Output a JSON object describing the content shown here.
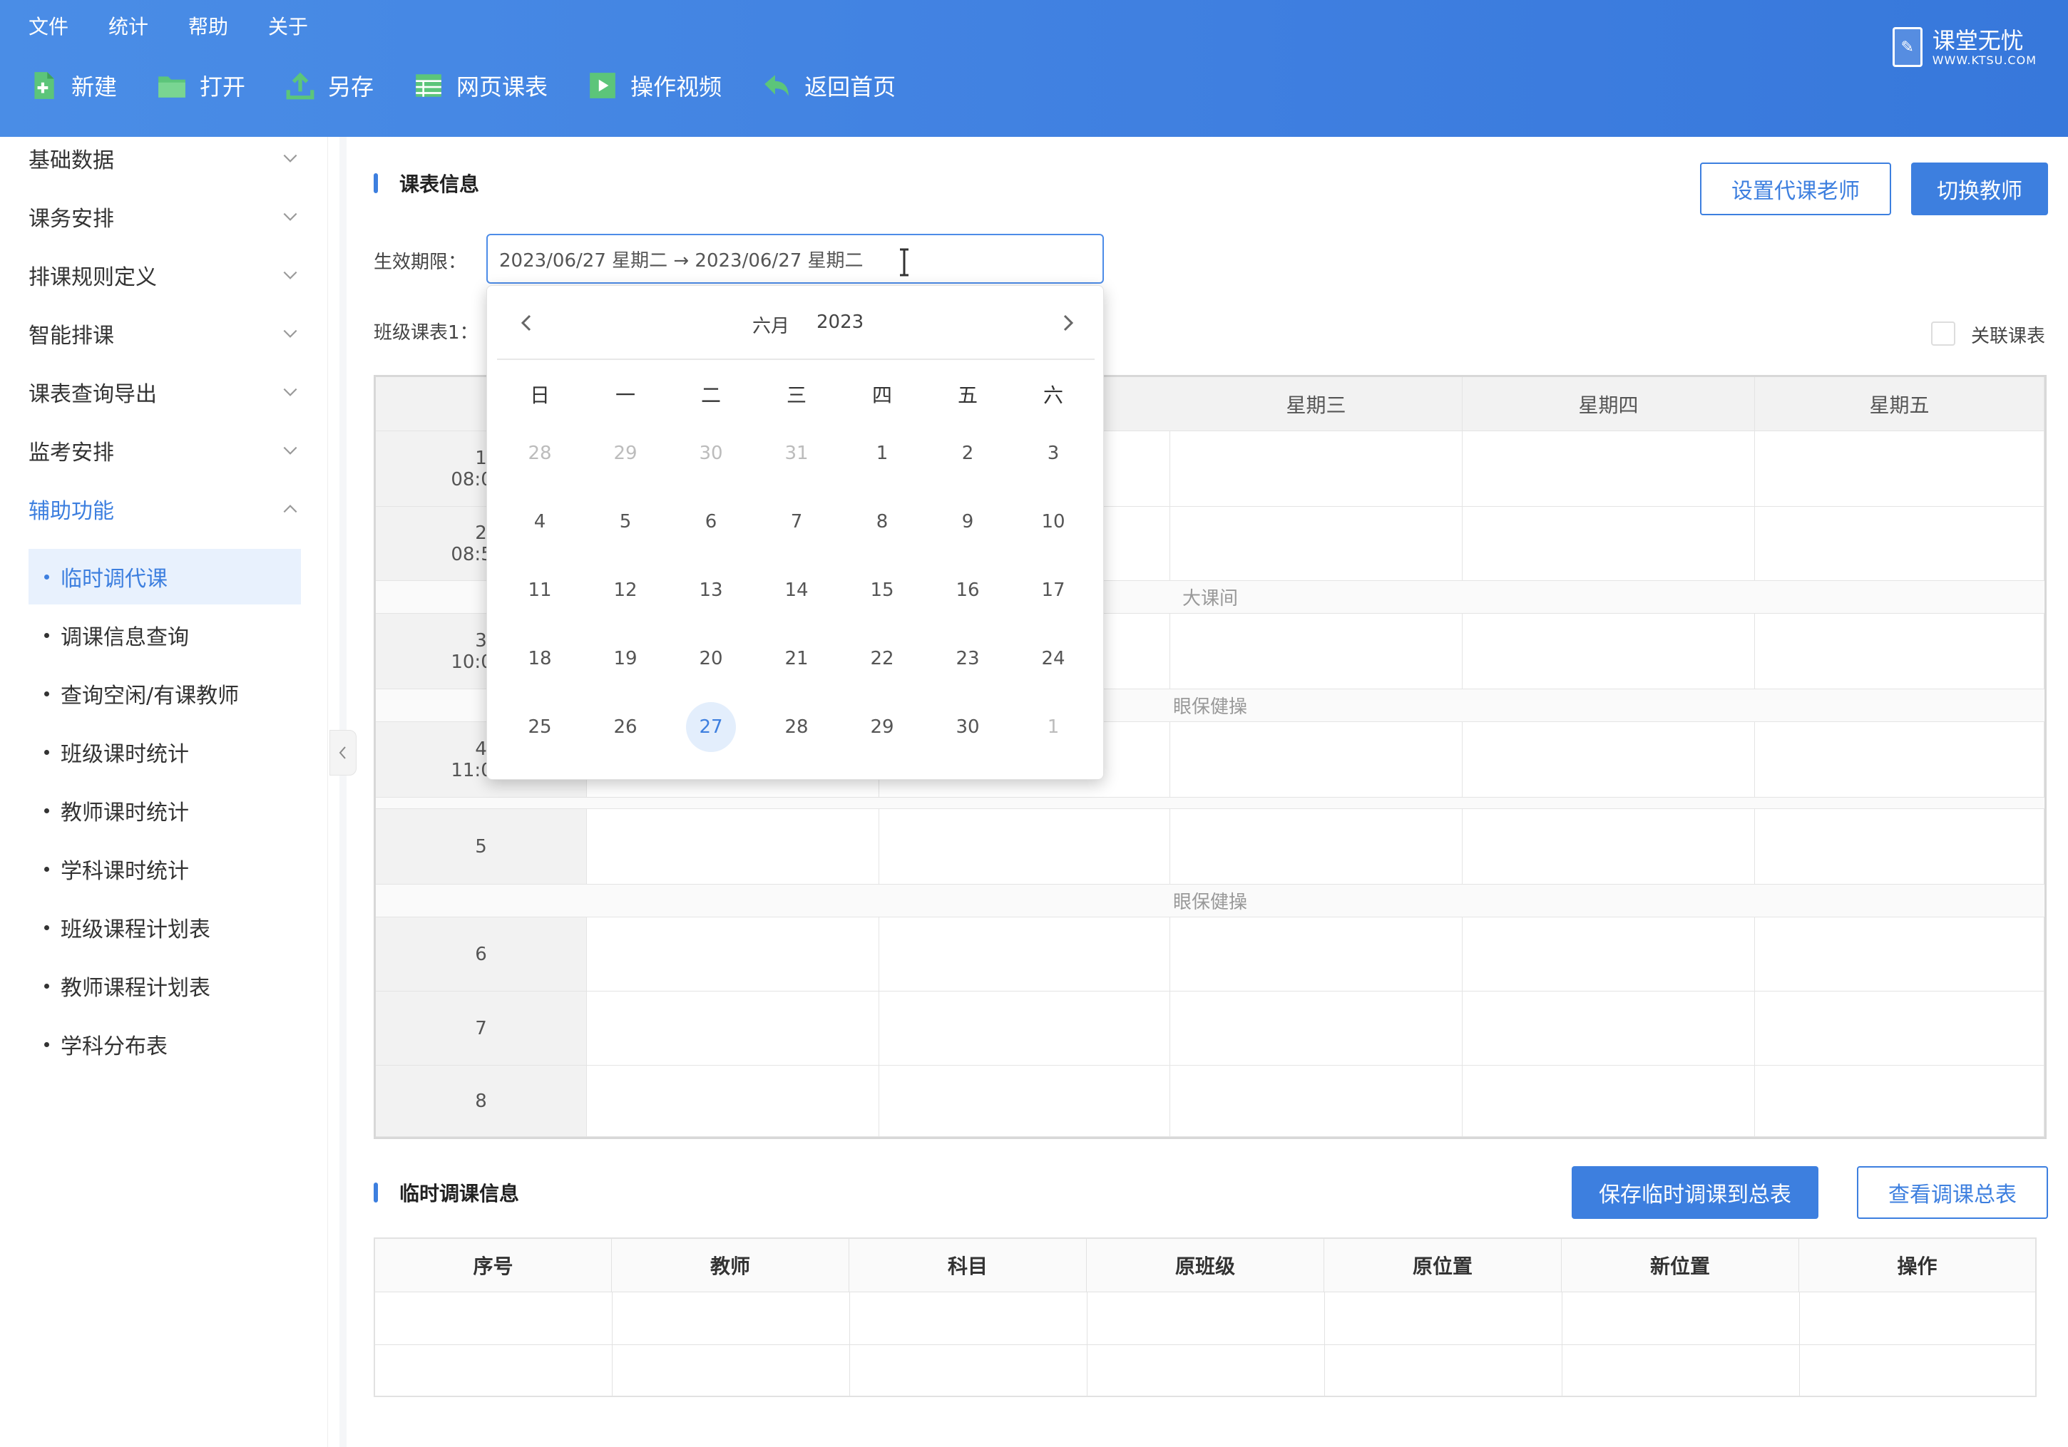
{
  "menu": [
    "文件",
    "统计",
    "帮助",
    "关于"
  ],
  "toolbar": [
    "新建",
    "打开",
    "另存",
    "网页课表",
    "操作视频",
    "返回首页"
  ],
  "logo": {
    "title": "课堂无忧",
    "sub": "WWW.KTSU.COM"
  },
  "sidebar": {
    "groups": [
      "基础数据",
      "课务安排",
      "排课规则定义",
      "智能排课",
      "课表查询导出",
      "监考安排",
      "辅助功能"
    ],
    "subitems": [
      "临时调代课",
      "调课信息查询",
      "查询空闲/有课教师",
      "班级课时统计",
      "教师课时统计",
      "学科课时统计",
      "班级课程计划表",
      "教师课程计划表",
      "学科分布表"
    ]
  },
  "main": {
    "section1": "课表信息",
    "btn_set_sub": "设置代课老师",
    "btn_switch": "切换教师",
    "label_period": "生效期限：",
    "date_value": "2023/06/27 星期二 → 2023/06/27 星期二",
    "label_class": "班级课表1：",
    "link_label": "关联课表",
    "schedule": {
      "days": [
        "星期三",
        "星期四",
        "星期五"
      ],
      "periods": [
        {
          "num": "1",
          "time": "08:00-"
        },
        {
          "num": "2",
          "time": "08:55-"
        },
        {
          "num": "3",
          "time": "10:00-"
        },
        {
          "num": "4",
          "time": "11:00-"
        },
        {
          "num": "5",
          "time": ""
        },
        {
          "num": "6",
          "time": ""
        },
        {
          "num": "7",
          "time": ""
        },
        {
          "num": "8",
          "time": ""
        }
      ],
      "breaks": [
        "大课间",
        "眼保健操",
        "眼保健操"
      ]
    },
    "section2": "临时调课信息",
    "btn_save": "保存临时调课到总表",
    "btn_view": "查看调课总表",
    "table_headers": [
      "序号",
      "教师",
      "科目",
      "原班级",
      "原位置",
      "新位置",
      "操作"
    ]
  },
  "calendar": {
    "month": "六月",
    "year": "2023",
    "weekdays": [
      "日",
      "一",
      "二",
      "三",
      "四",
      "五",
      "六"
    ],
    "weeks": [
      [
        "28",
        "29",
        "30",
        "31",
        "1",
        "2",
        "3"
      ],
      [
        "4",
        "5",
        "6",
        "7",
        "8",
        "9",
        "10"
      ],
      [
        "11",
        "12",
        "13",
        "14",
        "15",
        "16",
        "17"
      ],
      [
        "18",
        "19",
        "20",
        "21",
        "22",
        "23",
        "24"
      ],
      [
        "25",
        "26",
        "27",
        "28",
        "29",
        "30",
        "1"
      ]
    ],
    "selected": "27"
  }
}
